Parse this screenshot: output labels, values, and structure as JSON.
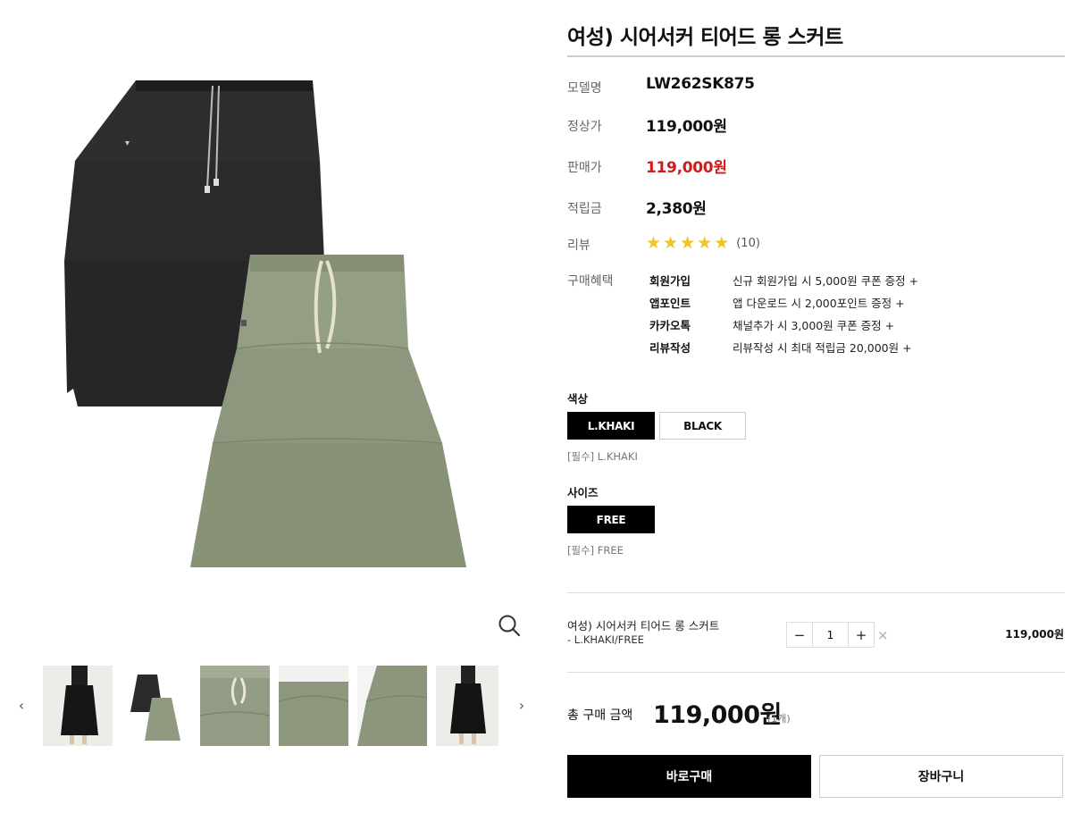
{
  "product": {
    "title": "여성) 시어서커 티어드 롱 스커트",
    "image_alt": "black and light khaki tiered long skirts"
  },
  "info": {
    "model_label": "모델명",
    "model_value": "LW262SK875",
    "regular_label": "정상가",
    "regular_value": "119,000원",
    "sale_label": "판매가",
    "sale_value": "119,000원",
    "points_label": "적립금",
    "points_value": "2,380원",
    "review_label": "리뷰",
    "review_rating": 5,
    "review_count": "(10)",
    "benefit_label": "구매혜택"
  },
  "benefits": [
    {
      "name": "회원가입",
      "desc": "신규 회원가입 시 5,000원 쿠폰 증정 +"
    },
    {
      "name": "앱포인트",
      "desc": "앱 다운로드 시 2,000포인트 증정 +"
    },
    {
      "name": "카카오톡",
      "desc": "채널추가 시 3,000원 쿠폰 증정 +"
    },
    {
      "name": "리뷰작성",
      "desc": "리뷰작성 시 최대 적립금 20,000원 +"
    }
  ],
  "color_option": {
    "label": "색상",
    "options": [
      "L.KHAKI",
      "BLACK"
    ],
    "selected": "L.KHAKI",
    "note": "[필수] L.KHAKI"
  },
  "size_option": {
    "label": "사이즈",
    "options": [
      "FREE"
    ],
    "selected": "FREE",
    "note": "[필수] FREE"
  },
  "selection": {
    "name": "여성) 시어서커 티어드 롱 스커트",
    "option": "- L.KHAKI/FREE",
    "minus": "−",
    "plus": "+",
    "quantity": "1",
    "remove": "×",
    "price": "119,000원"
  },
  "total": {
    "label": "총 구매 금액",
    "price": "119,000원",
    "count": "(1개)"
  },
  "actions": {
    "buy": "바로구매",
    "cart": "장바구니"
  },
  "gallery": {
    "prev": "‹",
    "next": "›"
  },
  "colors": {
    "black_skirt": "#2b2b2b",
    "khaki_skirt": "#8f9a80",
    "sale_red": "#d11a1a",
    "star": "#f3c322"
  }
}
